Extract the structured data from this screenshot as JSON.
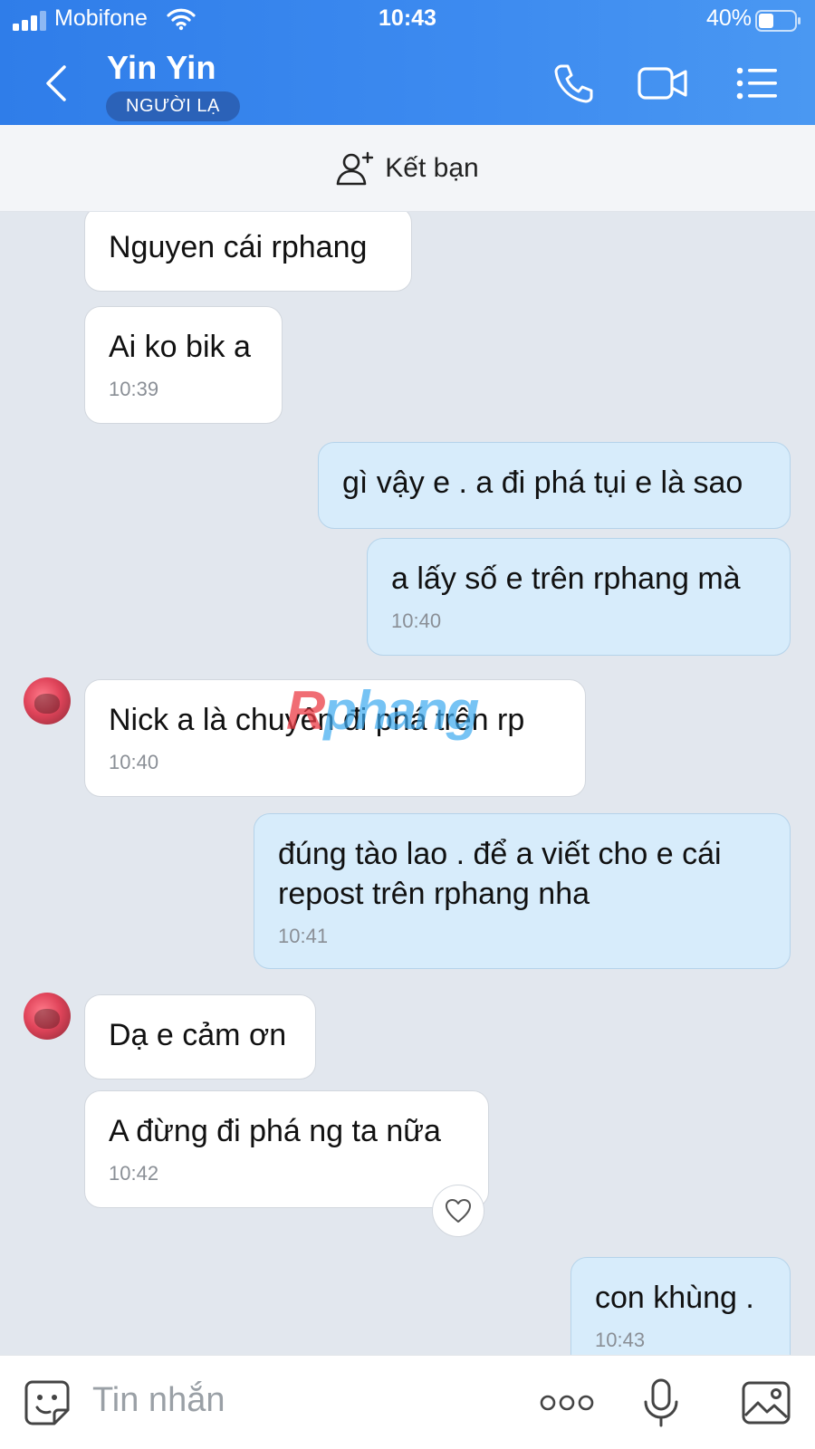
{
  "status_bar": {
    "carrier": "Mobifone",
    "time": "10:43",
    "battery_percent": "40%"
  },
  "header": {
    "contact_name": "Yin Yin",
    "badge": "NGƯỜI LẠ",
    "icons": [
      "back-icon",
      "phone-icon",
      "video-call-icon",
      "menu-list-icon"
    ]
  },
  "add_friend": {
    "label": "Kết bạn",
    "icon": "add-user-icon"
  },
  "messages": [
    {
      "side": "in",
      "text": "Nguyen cái rphang",
      "time": ""
    },
    {
      "side": "in",
      "text": "Ai ko bik a",
      "time": "10:39"
    },
    {
      "side": "out",
      "text": "gì vậy e . a đi phá tụi e là sao",
      "time": ""
    },
    {
      "side": "out",
      "text": "a lấy số e trên rphang mà",
      "time": "10:40"
    },
    {
      "side": "in",
      "text": "Nick a là chuyên đi phá trên rp",
      "time": "10:40"
    },
    {
      "side": "out",
      "text": "đúng tào lao . để a viết cho e cái repost trên rphang nha",
      "time": "10:41"
    },
    {
      "side": "in",
      "text": "Dạ e cảm ơn",
      "time": ""
    },
    {
      "side": "in",
      "text": "A đừng đi phá ng ta nữa",
      "time": "10:42"
    },
    {
      "side": "out",
      "text": "con khùng .",
      "time": "10:43"
    }
  ],
  "watermark": {
    "r": "R",
    "rest": "phang"
  },
  "input_bar": {
    "placeholder": "Tin nhắn",
    "icons": [
      "sticker-icon",
      "more-icon",
      "microphone-icon",
      "image-icon"
    ]
  },
  "colors": {
    "header_blue": "#3d8bf0",
    "outgoing_bubble": "#d7ecfb",
    "incoming_bubble": "#ffffff",
    "chat_background": "#e2e7ee"
  }
}
